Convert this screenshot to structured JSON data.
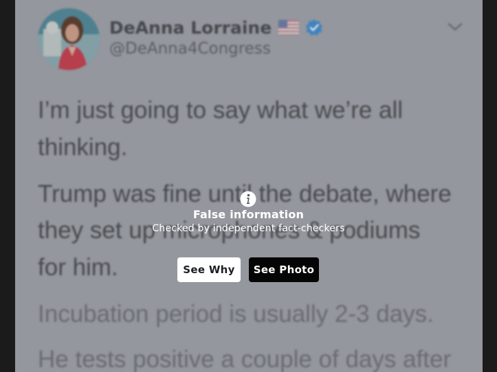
{
  "tweet": {
    "display_name": "DeAnna Lorraine",
    "handle": "@DeAnna4Congress",
    "lines": [
      "I’m just going to say what we’re all",
      "thinking.",
      "Trump was fine until the debate, where",
      "they set up microphones & podiums",
      "for him.",
      "Incubation period is usually 2-3 days.",
      "He tests positive a couple of days after"
    ]
  },
  "notice": {
    "title": "False information",
    "subtitle": "Checked by independent fact-checkers",
    "see_why_label": "See Why",
    "see_photo_label": "See Photo"
  },
  "icons": {
    "info": "info-icon",
    "verified": "verified-badge-icon",
    "flag": "us-flag-icon",
    "chevron": "chevron-down-icon"
  },
  "colors": {
    "verified_blue": "#3d8fd6",
    "see_why_bg": "#ffffff",
    "see_photo_bg": "#050505"
  }
}
